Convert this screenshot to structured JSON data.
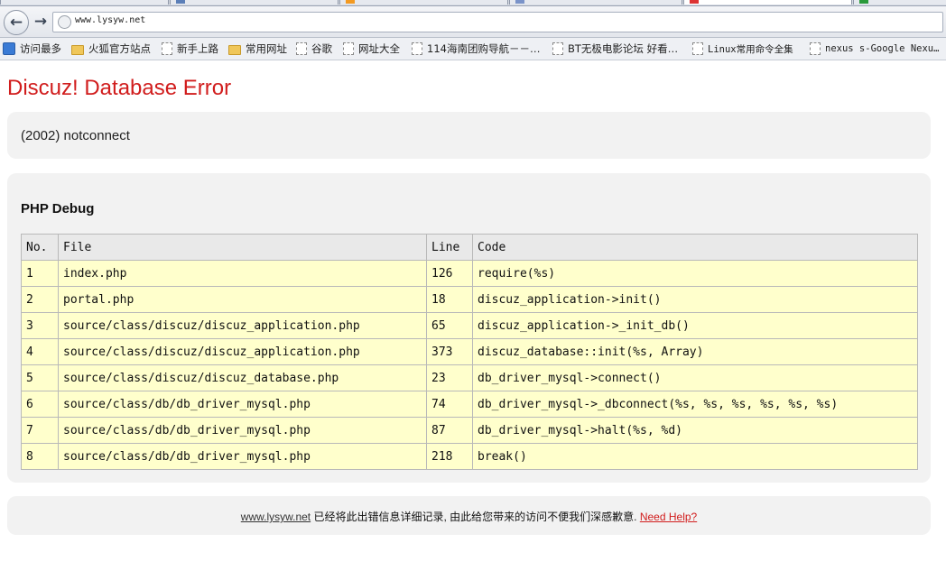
{
  "browser": {
    "url": "www.lysyw.net",
    "bookmarks": [
      "访问最多",
      "火狐官方站点",
      "新手上路",
      "常用网址",
      "谷歌",
      "网址大全",
      "114海南团购导航－－…",
      "BT无极电影论坛 好看…",
      "Linux常用命令全集",
      "nexus s-Google Nexu…"
    ]
  },
  "page": {
    "title": "Discuz! Database Error",
    "error_message": "(2002) notconnect",
    "debug_title": "PHP Debug",
    "table": {
      "headers": [
        "No.",
        "File",
        "Line",
        "Code"
      ],
      "rows": [
        [
          "1",
          "index.php",
          "126",
          "require(%s)"
        ],
        [
          "2",
          "portal.php",
          "18",
          "discuz_application->init()"
        ],
        [
          "3",
          "source/class/discuz/discuz_application.php",
          "65",
          "discuz_application->_init_db()"
        ],
        [
          "4",
          "source/class/discuz/discuz_application.php",
          "373",
          "discuz_database::init(%s, Array)"
        ],
        [
          "5",
          "source/class/discuz/discuz_database.php",
          "23",
          "db_driver_mysql->connect()"
        ],
        [
          "6",
          "source/class/db/db_driver_mysql.php",
          "74",
          "db_driver_mysql->_dbconnect(%s, %s, %s, %s, %s, %s)"
        ],
        [
          "7",
          "source/class/db/db_driver_mysql.php",
          "87",
          "db_driver_mysql->halt(%s, %d)"
        ],
        [
          "8",
          "source/class/db/db_driver_mysql.php",
          "218",
          "break()"
        ]
      ]
    },
    "footer": {
      "site_link": "www.lysyw.net",
      "message": " 已经将此出错信息详细记录, 由此给您带来的访问不便我们深感歉意. ",
      "help_link": "Need Help?"
    }
  },
  "colors": {
    "title": "#d11d1d",
    "box_bg": "#f2f2f2",
    "row_bg": "#ffffcc",
    "header_bg": "#e9e9e9"
  }
}
